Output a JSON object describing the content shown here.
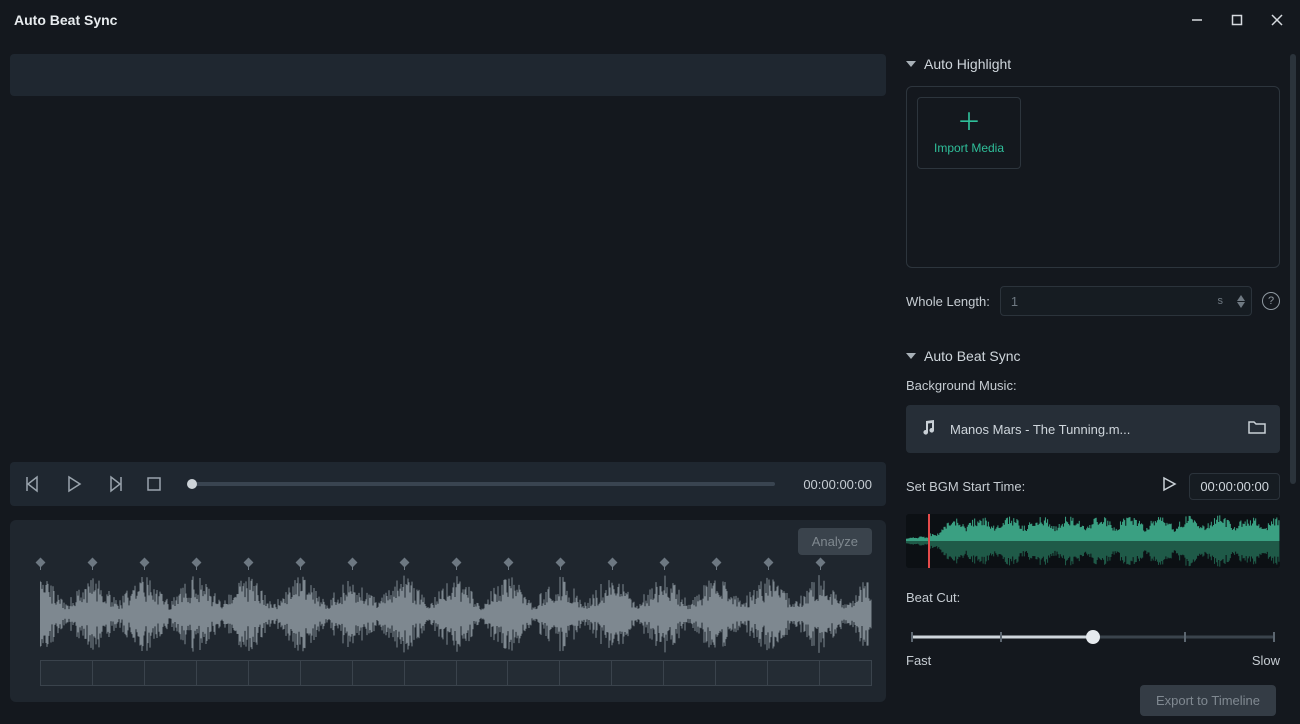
{
  "window": {
    "title": "Auto Beat Sync"
  },
  "transport": {
    "timecode": "00:00:00:00"
  },
  "analyze": {
    "label": "Analyze"
  },
  "export": {
    "label": "Export to Timeline"
  },
  "sections": {
    "autoHighlight": {
      "title": "Auto Highlight"
    },
    "autoBeatSync": {
      "title": "Auto Beat Sync"
    }
  },
  "importTile": {
    "label": "Import Media"
  },
  "wholeLength": {
    "label": "Whole Length:",
    "value": "1",
    "unit": "s"
  },
  "bgm": {
    "label": "Background Music:",
    "filename": "Manos Mars - The Tunning.m..."
  },
  "startTime": {
    "label": "Set BGM Start Time:",
    "value": "00:00:00:00"
  },
  "beatCut": {
    "label": "Beat Cut:",
    "fast": "Fast",
    "slow": "Slow"
  }
}
